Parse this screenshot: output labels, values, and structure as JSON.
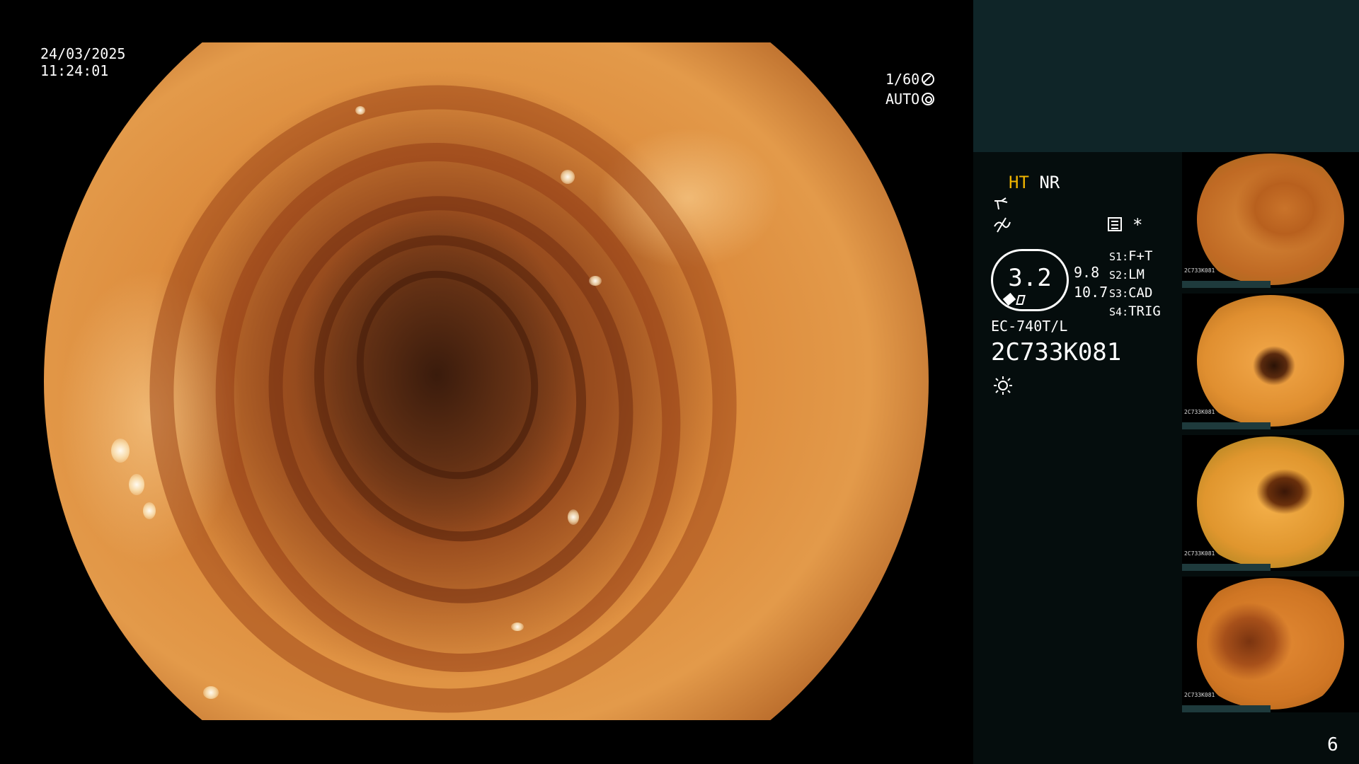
{
  "overlay": {
    "date": "24/03/2025",
    "time": "11:24:01",
    "shutter": "1/60",
    "mode": "AUTO"
  },
  "panel": {
    "ht": "HT",
    "nr": "NR",
    "star": "*",
    "gauge_value": "3.2",
    "gauge_side_1": "9.8",
    "gauge_side_2": "10.7",
    "settings": [
      {
        "key": "S1",
        "value": "F+T"
      },
      {
        "key": "S2",
        "value": "LM"
      },
      {
        "key": "S3",
        "value": "CAD"
      },
      {
        "key": "S4",
        "value": "TRIG"
      }
    ],
    "scope_model": "EC-740T/L",
    "scope_serial": "2C733K081",
    "page_number": "6",
    "highlight_color": "#f0b400"
  },
  "thumbnails": [
    {
      "serial": "2C733K081"
    },
    {
      "serial": "2C733K081"
    },
    {
      "serial": "2C733K081"
    },
    {
      "serial": "2C733K081"
    }
  ],
  "icons": [
    "shutter-icon",
    "auto-exposure-icon",
    "wave-filter-icon",
    "digital-gain-icon",
    "memo-icon",
    "light-icon"
  ]
}
